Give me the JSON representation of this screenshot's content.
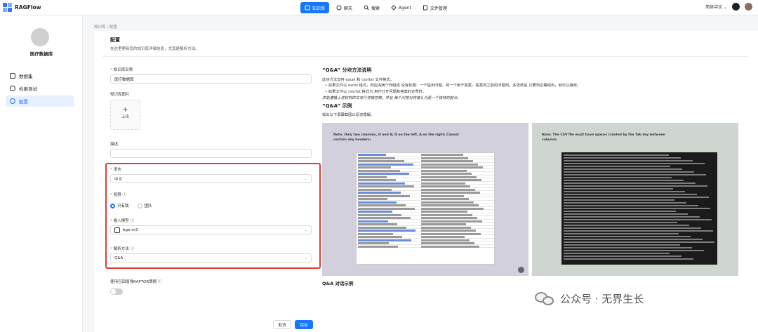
{
  "app": {
    "name": "RAGFlow"
  },
  "nav": [
    {
      "label": "知识库",
      "active": true,
      "icon": "library-icon"
    },
    {
      "label": "聊天",
      "active": false,
      "icon": "chat-icon"
    },
    {
      "label": "搜索",
      "active": false,
      "icon": "search-icon"
    },
    {
      "label": "Agent",
      "active": false,
      "icon": "agent-icon"
    },
    {
      "label": "文件管理",
      "active": false,
      "icon": "file-icon"
    }
  ],
  "topRight": {
    "language": "简体中文 ⌄"
  },
  "sidebar": {
    "kbName": "医疗数据库",
    "items": [
      {
        "label": "数据集",
        "active": false
      },
      {
        "label": "检索测试",
        "active": false
      },
      {
        "label": "配置",
        "active": true
      }
    ]
  },
  "breadcrumb": "知识库 / 配置",
  "page": {
    "title": "配置",
    "desc": "在这里更新您的知识库详细信息，尤其是解析方法。"
  },
  "form": {
    "nameLabel": "知识库名称",
    "nameValue": "医疗数据库",
    "imageLabel": "知识库图片",
    "uploadLabel": "上传",
    "uploadPlus": "+",
    "descLabel": "描述",
    "langLabel": "语言",
    "langValue": "中文",
    "permLabel": "权限 ⓘ",
    "permOptions": [
      "只有我",
      "团队"
    ],
    "embedLabel": "嵌入模型 ⓘ",
    "embedValue": "bge-m3",
    "parseLabel": "解析方法 ⓘ",
    "parseValue": "Q&A",
    "raptorLabel": "使用召回增强RAPTOR策略 ⓘ",
    "cancel": "取消",
    "save": "保存"
  },
  "info": {
    "title1": "“Q&A” 分块方法说明",
    "line1": "此块方法支持 excel 和 csv/txt 文件格式。",
    "bullet1": "• 如果文件以 excel 格式，则应由两个列组成 没有标题：一个提出问题，另一个用于答案，答案列之前的问题列。多张纸是 只要列正确结构，就可以接受。",
    "bullet2": "• 如果文件以 csv/txt 格式为 用作分开问题和答案的定界符。",
    "line2": "未能遵循上述规则的文本行将被忽略，并且 每个问答对将被认为是一个独特的部分。",
    "title2": "“Q&A” 示例",
    "line3": "提出以下屏幕截图以促进理解。",
    "imgLeftNote": "Note: Only two columns, Q and A; Q on the left, A on the right; Cannot contain any headers;",
    "imgRightNote": "Note: The CSV file must have spaces created by the Tab key between columns",
    "title3": "Q&A 对话示例"
  },
  "watermark": "公众号 · 无界生长"
}
